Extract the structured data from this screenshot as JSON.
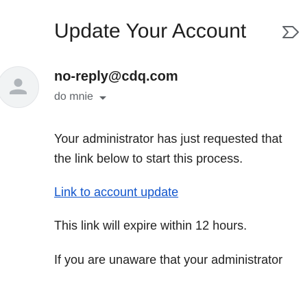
{
  "email": {
    "subject": "Update Your Account",
    "sender": "no-reply@cdq.com",
    "recipient": "do mnie",
    "body": {
      "line1": "Your administrator has just requested that",
      "line2": "the link below to start this process.",
      "link_text": "Link to account update",
      "expiry": "This link will expire within 12 hours.",
      "line5": "If you are unaware that your administrator"
    }
  },
  "icons": {
    "important": "important-marker-icon",
    "avatar": "person-icon",
    "recipient_details": "caret-down-icon"
  },
  "colors": {
    "link": "#1155cc",
    "secondary_text": "#5f6368",
    "avatar_bg": "#f1f3f4"
  }
}
